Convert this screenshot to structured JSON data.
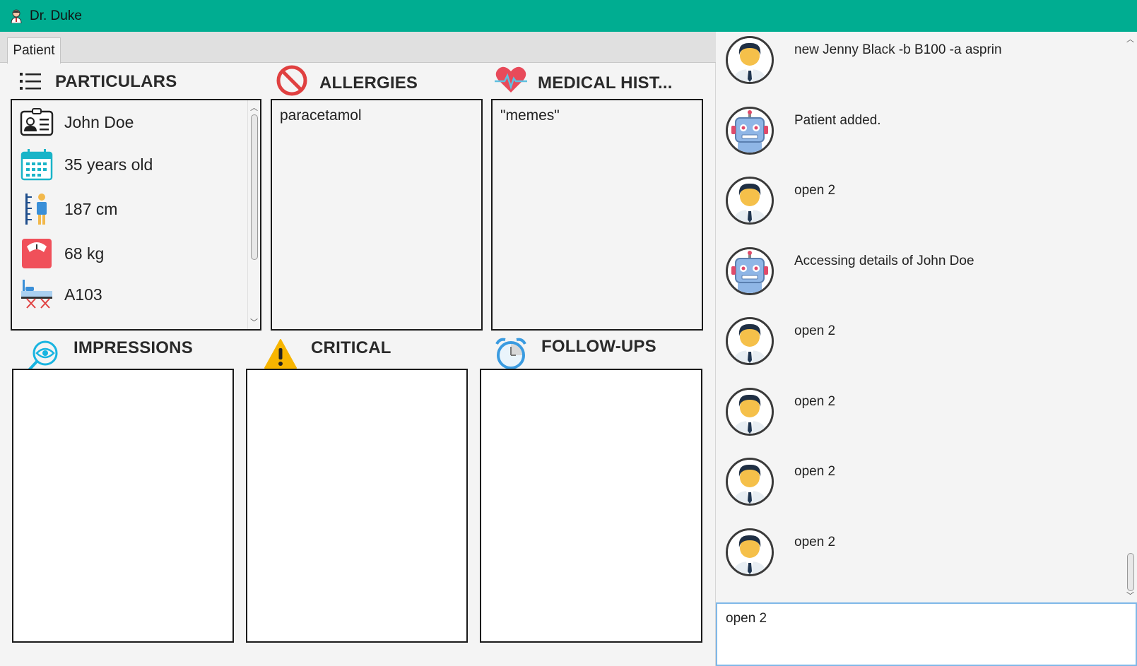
{
  "window": {
    "title": "Dr. Duke"
  },
  "tabs": [
    {
      "label": "Patient"
    }
  ],
  "particulars": {
    "title": "PARTICULARS",
    "name": "John Doe",
    "age": "35 years old",
    "height": "187 cm",
    "weight": "68 kg",
    "bed": "A103"
  },
  "allergies": {
    "title": "ALLERGIES",
    "items": [
      "paracetamol"
    ]
  },
  "medical_history": {
    "title": "MEDICAL HIST...",
    "items": [
      "\"memes\""
    ]
  },
  "impressions": {
    "title": "IMPRESSIONS"
  },
  "critical": {
    "title": "CRITICAL"
  },
  "followups": {
    "title": "FOLLOW-UPS"
  },
  "chat": {
    "messages": [
      {
        "sender": "doctor",
        "text": "new Jenny Black -b B100 -a asprin"
      },
      {
        "sender": "bot",
        "text": "Patient added."
      },
      {
        "sender": "doctor",
        "text": "open 2"
      },
      {
        "sender": "bot",
        "text": "Accessing details of John Doe"
      },
      {
        "sender": "doctor",
        "text": "open 2"
      },
      {
        "sender": "doctor",
        "text": "open 2"
      },
      {
        "sender": "doctor",
        "text": "open 2"
      },
      {
        "sender": "doctor",
        "text": "open 2"
      }
    ]
  },
  "command": {
    "value": "open 2"
  },
  "colors": {
    "titlebar": "#00ad91",
    "accent_blue": "#7fb8e8"
  },
  "icons": {
    "app": "doctor-icon",
    "particulars": "list-icon",
    "allergies": "prohibited-icon",
    "medical_history": "heartbeat-icon",
    "impressions": "eye-search-icon",
    "critical": "warning-icon",
    "followups": "alarm-clock-icon"
  }
}
